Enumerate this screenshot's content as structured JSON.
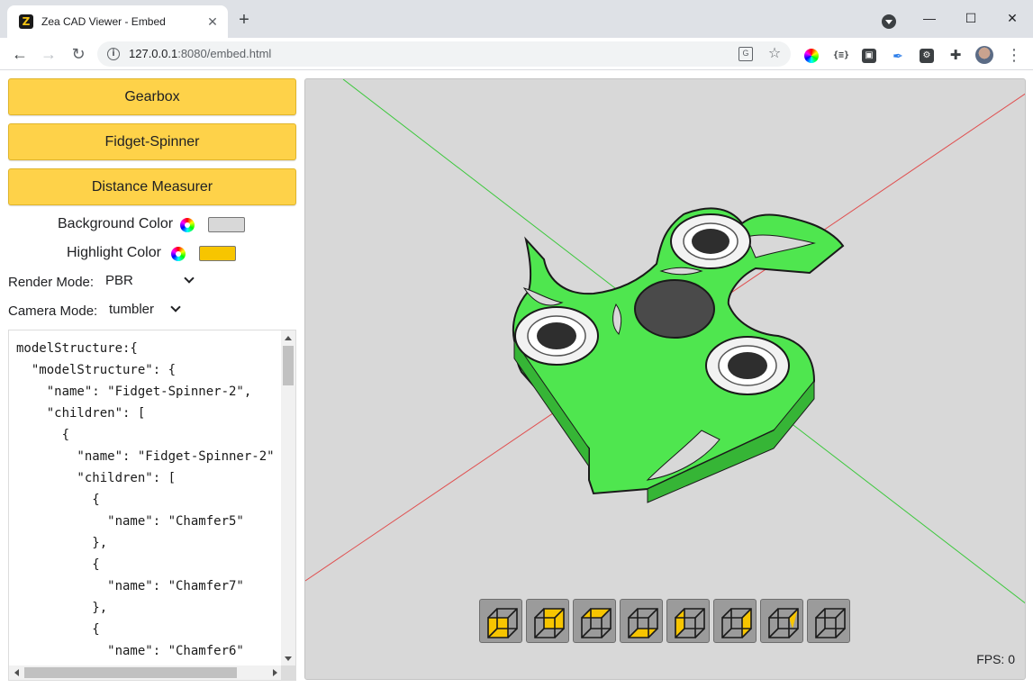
{
  "browser": {
    "tab_title": "Zea CAD Viewer - Embed",
    "favicon_letter": "Z",
    "new_tab_symbol": "+",
    "url_host": "127.0.0.1",
    "url_path": ":8080/embed.html",
    "window_controls": [
      "minimize-icon",
      "maximize-icon",
      "close-icon"
    ],
    "extensions": [
      "color-picker-icon",
      "json-viewer-icon",
      "devtools-extension-icon",
      "feather-icon",
      "hub-extension-icon",
      "puzzle-extensions-icon"
    ]
  },
  "panel": {
    "buttons": {
      "gearbox": "Gearbox",
      "fidget_spinner": "Fidget-Spinner",
      "distance_measurer": "Distance Measurer"
    },
    "background_color": {
      "label": "Background Color",
      "value": "#d8d8d8"
    },
    "highlight_color": {
      "label": "Highlight Color",
      "value": "#f7c500"
    },
    "render_mode": {
      "label": "Render Mode:",
      "value": "PBR"
    },
    "camera_mode": {
      "label": "Camera Mode:",
      "value": "tumbler"
    },
    "model_structure_lines": [
      "modelStructure:{",
      "  \"modelStructure\": {",
      "    \"name\": \"Fidget-Spinner-2\",",
      "    \"children\": [",
      "      {",
      "        \"name\": \"Fidget-Spinner-2\"",
      "        \"children\": [",
      "          {",
      "            \"name\": \"Chamfer5\"",
      "          },",
      "          {",
      "            \"name\": \"Chamfer7\"",
      "          },",
      "          {",
      "            \"name\": \"Chamfer6\""
    ]
  },
  "viewport": {
    "fps": "FPS: 0",
    "axis_colors": {
      "x": "#e05050",
      "y": "#3cc83c"
    },
    "model_color": "#4fe64f",
    "view_buttons": [
      "front-view-icon",
      "back-view-icon",
      "top-view-icon",
      "bottom-view-icon",
      "left-view-icon",
      "right-view-icon",
      "perspective-view-icon",
      "frame-view-icon"
    ]
  }
}
